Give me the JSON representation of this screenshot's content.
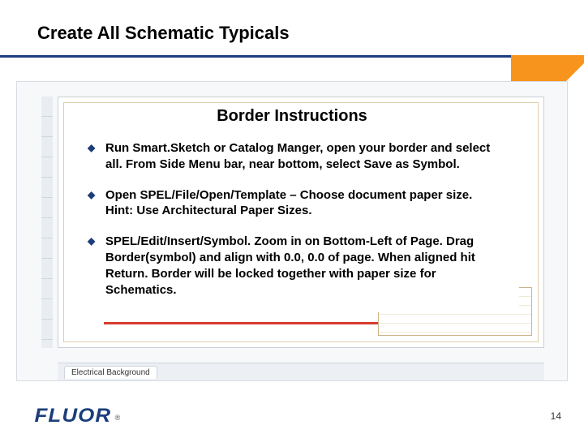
{
  "title": "Create All Schematic Typicals",
  "subheading": "Border Instructions",
  "bullets": [
    "Run Smart.Sketch or Catalog Manger, open your border and select all.  From Side Menu bar, near bottom, select Save as Symbol.",
    "Open SPEL/File/Open/Template – Choose document paper size. Hint:  Use Architectural Paper Sizes.",
    "SPEL/Edit/Insert/Symbol.  Zoom in on Bottom-Left of Page.  Drag Border(symbol) and align with 0.0, 0.0 of page.  When aligned hit Return.  Border will be locked together with paper size for Schematics."
  ],
  "screenshot_tab": "Electrical Background",
  "logo_text": "FLUOR",
  "logo_registered": "®",
  "page_number": "14"
}
